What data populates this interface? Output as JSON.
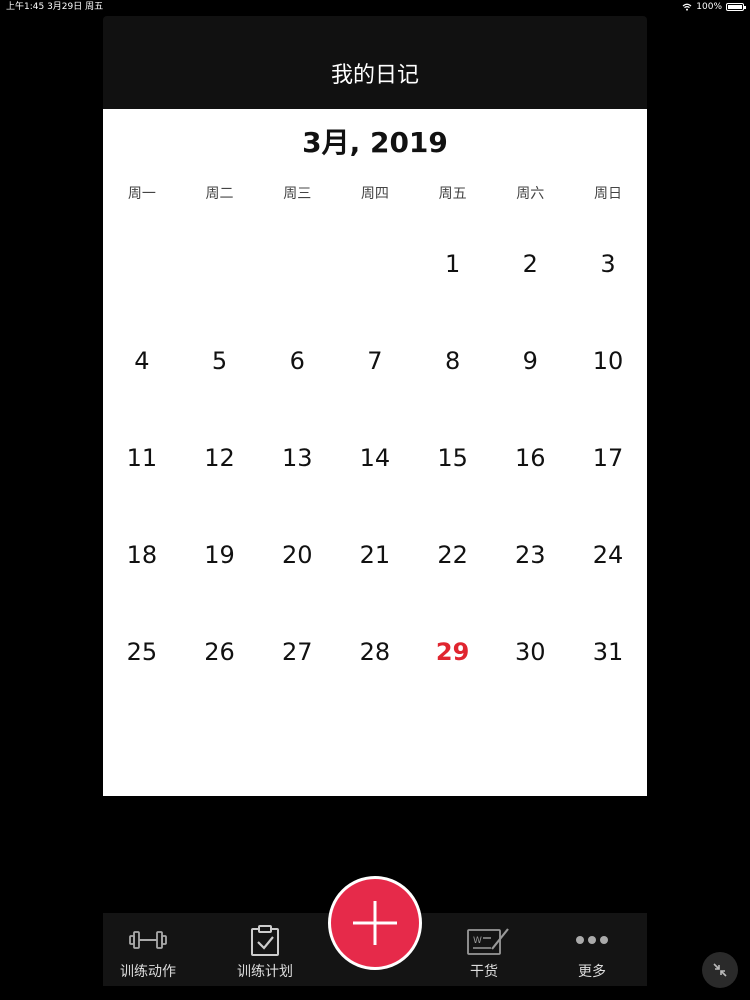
{
  "status_bar": {
    "left": "上午1:45   3月29日 周五",
    "battery": "100%"
  },
  "nav": {
    "title": "我的日记"
  },
  "calendar": {
    "month_title": "3月, 2019",
    "weekdays": [
      "周一",
      "周二",
      "周三",
      "周四",
      "周五",
      "周六",
      "周日"
    ],
    "leading_blanks": 4,
    "days": [
      "1",
      "2",
      "3",
      "4",
      "5",
      "6",
      "7",
      "8",
      "9",
      "10",
      "11",
      "12",
      "13",
      "14",
      "15",
      "16",
      "17",
      "18",
      "19",
      "20",
      "21",
      "22",
      "23",
      "24",
      "25",
      "26",
      "27",
      "28",
      "29",
      "30",
      "31"
    ],
    "today": "29",
    "today_color": "#e0252f"
  },
  "tabbar": {
    "tabs": [
      {
        "label": "训练动作",
        "icon": "dumbbell-icon"
      },
      {
        "label": "训练计划",
        "icon": "clipboard-check-icon"
      },
      {
        "label": "干货",
        "icon": "article-edit-icon"
      },
      {
        "label": "更多",
        "icon": "more-dots-icon"
      }
    ],
    "add_button_icon": "plus-icon",
    "accent_color": "#e62a4a"
  }
}
